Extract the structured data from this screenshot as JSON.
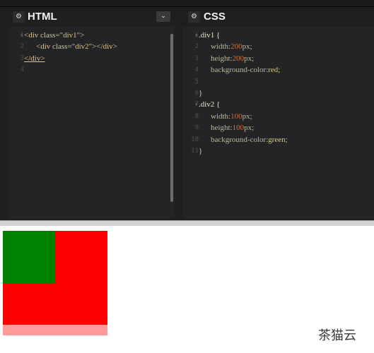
{
  "html_panel": {
    "title": "HTML",
    "gear_icon": "⚙",
    "dropdown_icon": "⌄",
    "line_numbers": [
      "1",
      "2",
      "3",
      "4"
    ]
  },
  "css_panel": {
    "title": "CSS",
    "gear_icon": "⚙",
    "line_numbers": [
      "1",
      "2",
      "3",
      "4",
      "5",
      "6",
      "7",
      "8",
      "9",
      "10",
      "11"
    ]
  },
  "html_code": {
    "l1_open": "<div ",
    "l1_attr": "class=",
    "l1_str": "\"div1\"",
    "l1_close": ">",
    "l2_open": "<div ",
    "l2_attr": "class=",
    "l2_str": "\"div2\"",
    "l2_close": "></div>",
    "l3": "</div>"
  },
  "css_code": {
    "sel1": ".div1 {",
    "w_prop": "width:",
    "w1_num": "200",
    "w1_unit": "px;",
    "h_prop": "height:",
    "h1_num": "200",
    "h1_unit": "px;",
    "bg_prop": "background-color:",
    "bg1": "red;",
    "close": "}",
    "sel2": ".div2 {",
    "w2_num": "100",
    "w2_unit": "px;",
    "h2_num": "100",
    "h2_unit": "px;",
    "bg2": "green;"
  },
  "result": {
    "div1_color": "#ff0000",
    "div2_color": "#008000"
  },
  "watermark": "茶猫云",
  "colors": {
    "editor_bg": "#222426",
    "header_bg": "#1d1f20",
    "number": "#d4703a",
    "string": "#d9c58a"
  }
}
